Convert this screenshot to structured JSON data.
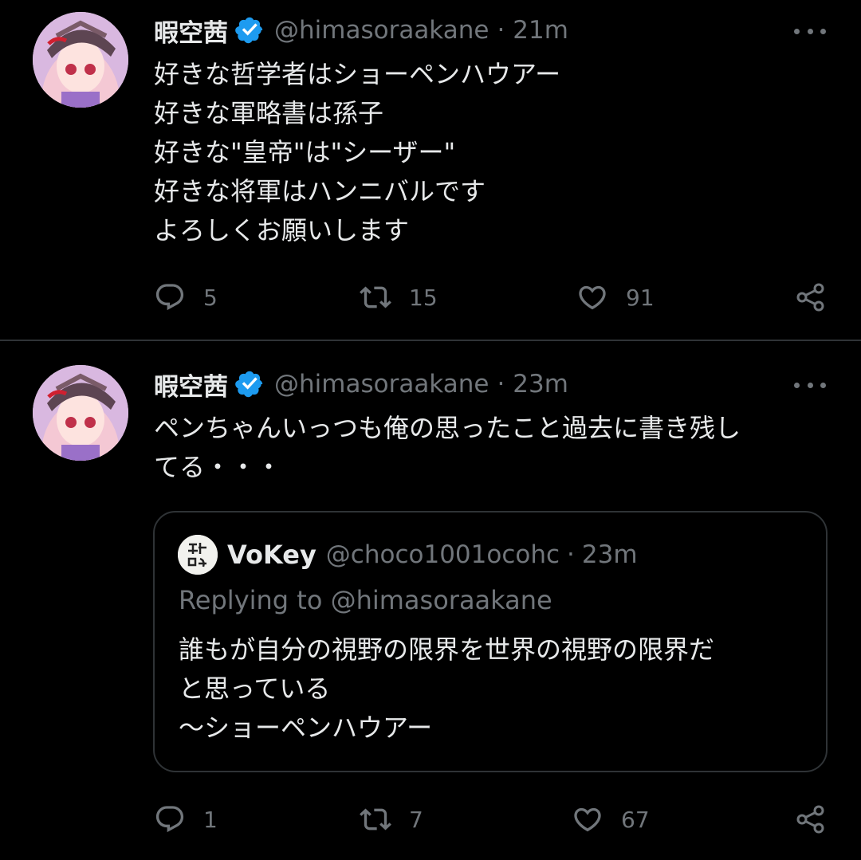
{
  "tweets": [
    {
      "author": {
        "name": "暇空茜",
        "handle": "@himasoraakane",
        "verified": true
      },
      "time": "21m",
      "lines": [
        "好きな哲学者はショーペンハウアー",
        "好きな軍略書は孫子",
        "好きな\"皇帝\"は\"シーザー\"",
        "好きな将軍はハンニバルです",
        "よろしくお願いします"
      ],
      "stats": {
        "replies": "5",
        "retweets": "15",
        "likes": "91"
      }
    },
    {
      "author": {
        "name": "暇空茜",
        "handle": "@himasoraakane",
        "verified": true
      },
      "time": "23m",
      "lines": [
        "ペンちゃんいっつも俺の思ったこと過去に書き残し",
        "てる・・・"
      ],
      "quote": {
        "author": {
          "name": "VoKey",
          "handle": "@choco1001ocohc"
        },
        "time": "23m",
        "replying_to": "Replying to @himasoraakane",
        "lines": [
          "誰もが自分の視野の限界を世界の視野の限界だ",
          "と思っている",
          "〜ショーペンハウアー"
        ]
      },
      "stats": {
        "replies": "1",
        "retweets": "7",
        "likes": "67"
      }
    }
  ],
  "separator": "·",
  "colors": {
    "background": "#000000",
    "text": "#e7e9ea",
    "secondary": "#71767b",
    "verified": "#1d9bf0",
    "border": "#2f3336"
  },
  "icons": [
    "verified-badge-icon",
    "more-icon",
    "reply-icon",
    "retweet-icon",
    "like-icon",
    "share-icon"
  ]
}
